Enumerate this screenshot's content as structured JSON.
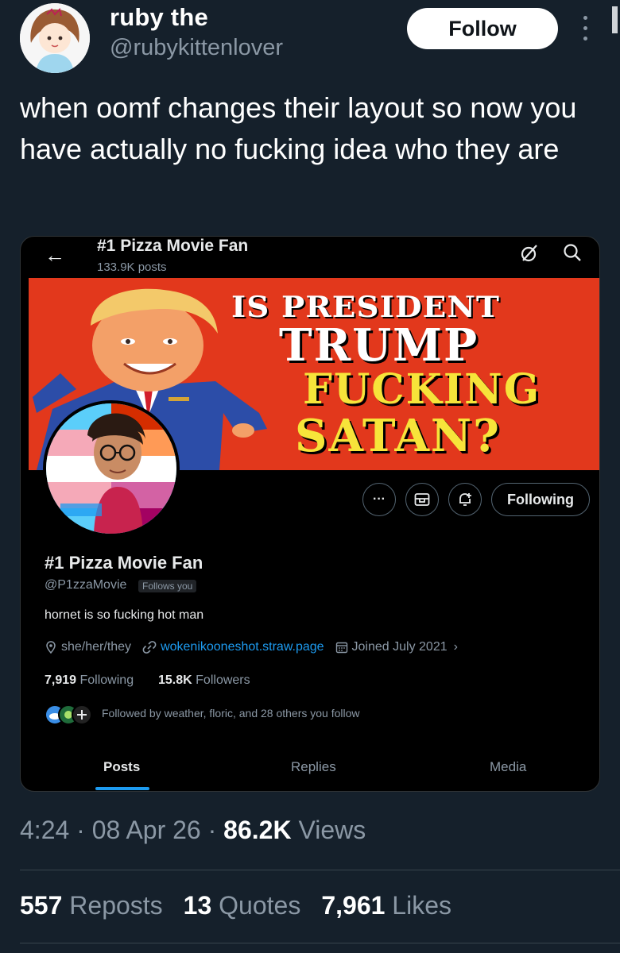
{
  "tweet": {
    "author_name": "ruby the",
    "author_handle": "@rubykittenlover",
    "follow_label": "Follow",
    "text": "when oomf changes their layout so now you have actually no fucking idea who they are",
    "timestamp": {
      "time": "4:24",
      "date": "08 Apr 26",
      "views_count": "86.2K",
      "views_label": "Views"
    },
    "stats": {
      "reposts_count": "557",
      "reposts_label": "Reposts",
      "quotes_count": "13",
      "quotes_label": "Quotes",
      "likes_count": "7,961",
      "likes_label": "Likes"
    }
  },
  "screenshot": {
    "header_title": "#1 Pizza Movie Fan",
    "header_posts": "133.9K posts",
    "banner": {
      "line1": "IS PRESIDENT",
      "line2": "TRUMP",
      "line3": "FUCKING",
      "line4": "SATAN?"
    },
    "following_label": "Following",
    "profile_name": "#1 Pizza Movie Fan",
    "profile_handle": "@P1zzaMovie",
    "follows_you": "Follows you",
    "bio": "hornet is so fucking hot man",
    "pronouns": "she/her/they",
    "website": "wokenikooneshot.straw.page",
    "joined": "Joined July 2021",
    "following_count": "7,919",
    "following_text": "Following",
    "followers_count": "15.8K",
    "followers_text": "Followers",
    "followed_by": "Followed by weather, floric, and 28 others you follow",
    "tabs": [
      "Posts",
      "Replies",
      "Media"
    ]
  },
  "colors": {
    "background": "#15202b",
    "banner_red": "#e2381c",
    "banner_yellow": "#f7e43a",
    "link_blue": "#1d9bf0",
    "muted": "#8b98a5"
  }
}
